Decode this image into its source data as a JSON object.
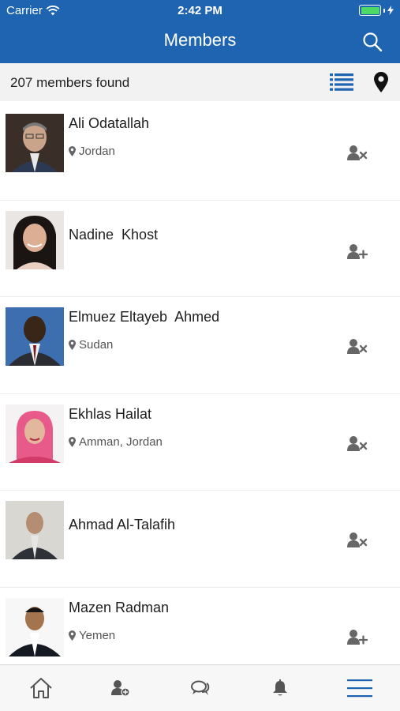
{
  "status_bar": {
    "carrier": "Carrier",
    "time": "2:42 PM",
    "battery_level": 1.0
  },
  "header": {
    "title": "Members",
    "search_icon": "search-icon"
  },
  "subbar": {
    "count_text": "207 members found",
    "list_icon": "list-view-icon",
    "map_icon": "map-pin-icon"
  },
  "members": [
    {
      "name": "Ali Odatallah",
      "location": "Jordan",
      "action_icon": "remove-friend-icon"
    },
    {
      "name": "Nadine  Khost",
      "location": "",
      "action_icon": "add-friend-icon"
    },
    {
      "name": "Elmuez Eltayeb  Ahmed",
      "location": "Sudan",
      "action_icon": "remove-friend-icon"
    },
    {
      "name": "Ekhlas Hailat",
      "location": "Amman, Jordan",
      "action_icon": "remove-friend-icon"
    },
    {
      "name": "Ahmad Al-Talafih",
      "location": "",
      "action_icon": "remove-friend-icon"
    },
    {
      "name": "Mazen Radman",
      "location": "Yemen",
      "action_icon": "add-friend-icon"
    }
  ],
  "tabbar": {
    "items": [
      "home-icon",
      "member-add-icon",
      "chat-icon",
      "bell-icon",
      "menu-icon"
    ]
  },
  "colors": {
    "header_bg": "#1f64b1",
    "accent": "#1f64b1",
    "battery": "#4cd964"
  }
}
